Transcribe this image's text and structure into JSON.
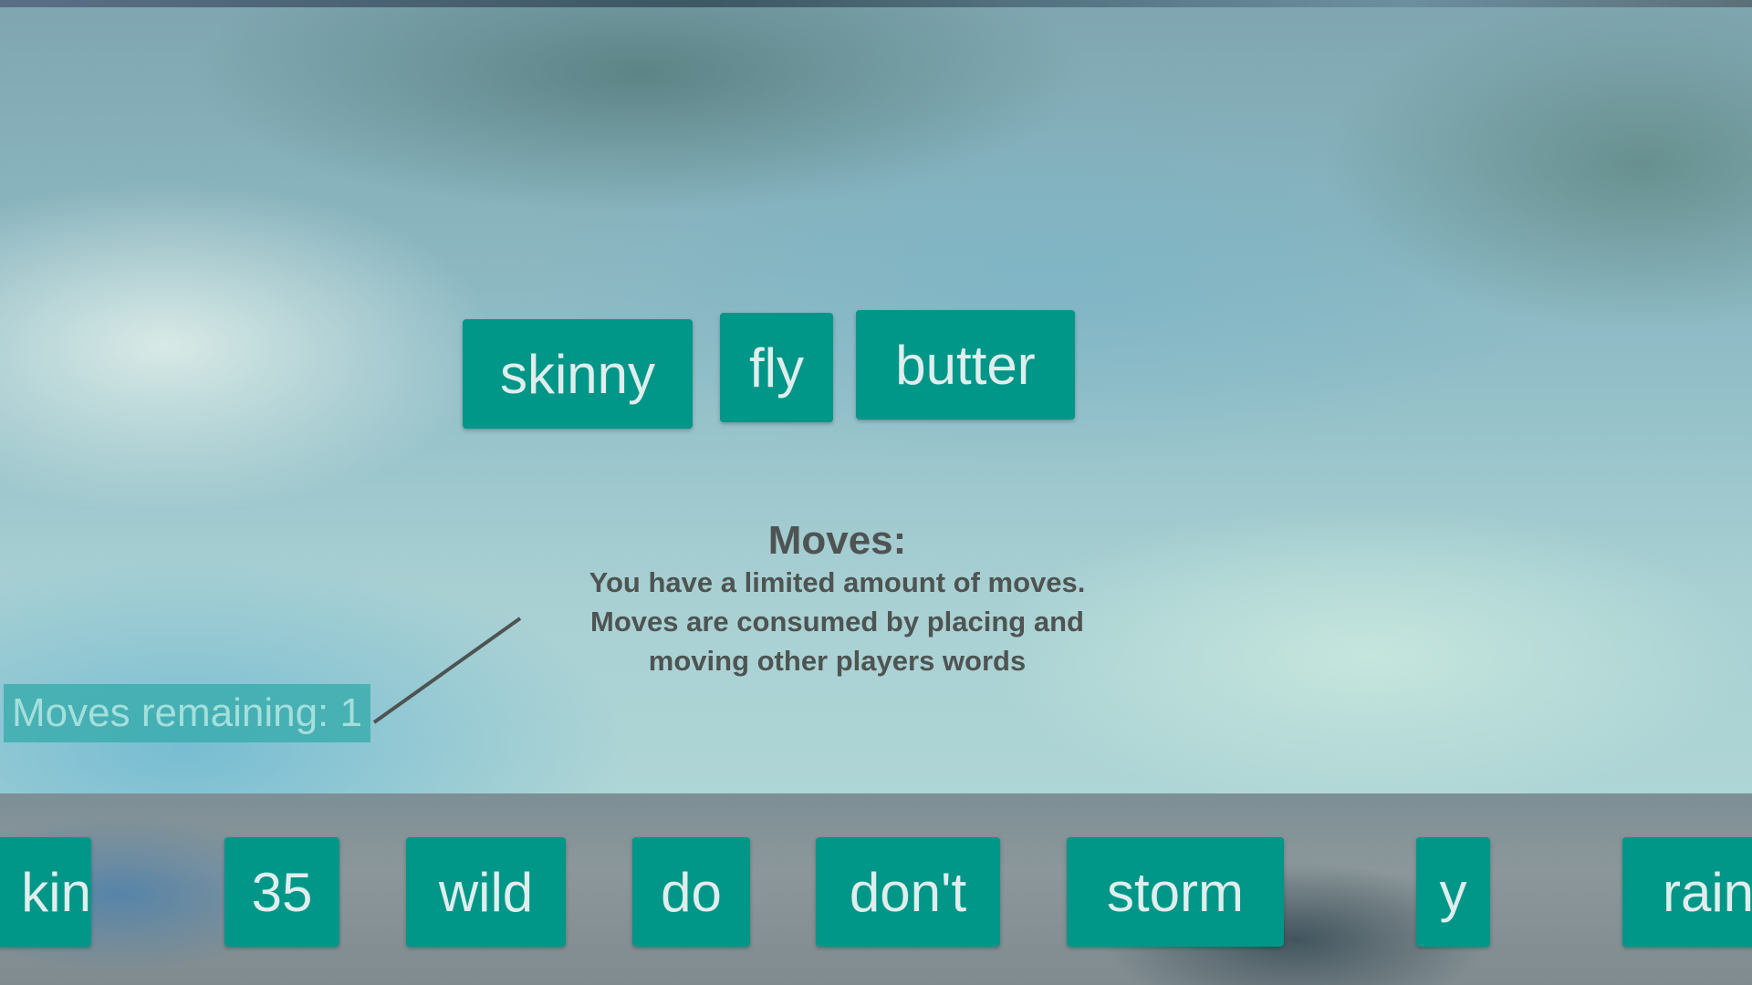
{
  "board": {
    "words": [
      "skinny",
      "fly",
      "butter"
    ]
  },
  "help": {
    "title": "Moves:",
    "lines": [
      "You have a limited amount of moves.",
      "Moves are consumed by placing and",
      "moving other players words"
    ]
  },
  "moves_badge": {
    "text": "Moves remaining: 1",
    "moves_remaining": 1
  },
  "tray": {
    "words": [
      "kin",
      "35",
      "wild",
      "do",
      "don't",
      "storm",
      "y",
      "rain"
    ]
  },
  "colors": {
    "tile": "#009688",
    "tile_text": "#dfeeed",
    "help_text": "#4e5452"
  }
}
